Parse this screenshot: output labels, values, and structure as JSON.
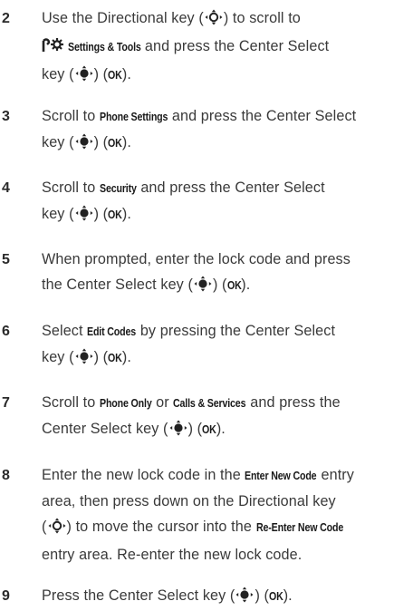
{
  "steps": [
    {
      "number": "2",
      "lines": [
        [
          {
            "t": "Use the Directional key ("
          },
          {
            "icon": "nav-key"
          },
          {
            "t": ") to scroll to"
          }
        ],
        [
          {
            "icon": "settings"
          },
          {
            "t": " "
          },
          {
            "k": "Settings & Tools"
          },
          {
            "t": " and press the Center Select"
          }
        ],
        [
          {
            "t": "key ("
          },
          {
            "icon": "center-key"
          },
          {
            "t": ") ("
          },
          {
            "k": "OK"
          },
          {
            "t": ")."
          }
        ]
      ]
    },
    {
      "number": "3",
      "lines": [
        [
          {
            "t": "Scroll to "
          },
          {
            "k": "Phone Settings"
          },
          {
            "t": " and press the Center Select"
          }
        ],
        [
          {
            "t": "key ("
          },
          {
            "icon": "center-key"
          },
          {
            "t": ") ("
          },
          {
            "k": "OK"
          },
          {
            "t": ")."
          }
        ]
      ]
    },
    {
      "number": "4",
      "lines": [
        [
          {
            "t": "Scroll to "
          },
          {
            "k": "Security"
          },
          {
            "t": " and press the Center Select"
          }
        ],
        [
          {
            "t": "key ("
          },
          {
            "icon": "center-key"
          },
          {
            "t": ") ("
          },
          {
            "k": "OK"
          },
          {
            "t": ")."
          }
        ]
      ]
    },
    {
      "number": "5",
      "lines": [
        [
          {
            "t": "When prompted, enter the lock code and press"
          }
        ],
        [
          {
            "t": "the Center Select key ("
          },
          {
            "icon": "center-key"
          },
          {
            "t": ") ("
          },
          {
            "k": "OK"
          },
          {
            "t": ")."
          }
        ]
      ]
    },
    {
      "number": "6",
      "lines": [
        [
          {
            "t": "Select "
          },
          {
            "k": "Edit Codes"
          },
          {
            "t": " by pressing the Center Select"
          }
        ],
        [
          {
            "t": "key ("
          },
          {
            "icon": "center-key"
          },
          {
            "t": ") ("
          },
          {
            "k": "OK"
          },
          {
            "t": ")."
          }
        ]
      ]
    },
    {
      "number": "7",
      "lines": [
        [
          {
            "t": "Scroll to "
          },
          {
            "k": "Phone Only"
          },
          {
            "t": " or "
          },
          {
            "k": "Calls & Services"
          },
          {
            "t": " and press the"
          }
        ],
        [
          {
            "t": "Center Select key ("
          },
          {
            "icon": "center-key"
          },
          {
            "t": ") ("
          },
          {
            "k": "OK"
          },
          {
            "t": ")."
          }
        ]
      ]
    },
    {
      "number": "8",
      "lines": [
        [
          {
            "t": "Enter the new lock code in the "
          },
          {
            "k": "Enter New Code"
          },
          {
            "t": " entry"
          }
        ],
        [
          {
            "t": "area, then press down on the Directional key"
          }
        ],
        [
          {
            "t": "("
          },
          {
            "icon": "nav-key"
          },
          {
            "t": ") to move the cursor into the "
          },
          {
            "k": "Re-Enter New Code"
          }
        ],
        [
          {
            "t": "entry area. Re-enter the new lock code."
          }
        ]
      ]
    },
    {
      "number": "9",
      "lines": [
        [
          {
            "t": "Press the Center Select key ("
          },
          {
            "icon": "center-key"
          },
          {
            "t": ") ("
          },
          {
            "k": "OK"
          },
          {
            "t": ")."
          }
        ]
      ]
    }
  ]
}
